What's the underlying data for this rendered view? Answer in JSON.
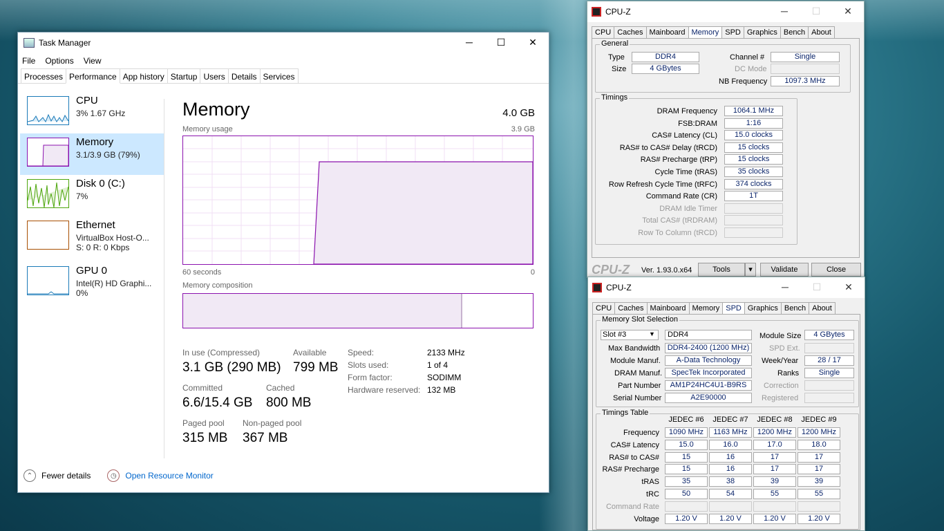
{
  "tm": {
    "title": "Task Manager",
    "menu": [
      "File",
      "Options",
      "View"
    ],
    "tabs": [
      "Processes",
      "Performance",
      "App history",
      "Startup",
      "Users",
      "Details",
      "Services"
    ],
    "sidebar": [
      {
        "name": "CPU",
        "sub": "3%  1.67 GHz",
        "sub2": ""
      },
      {
        "name": "Memory",
        "sub": "3.1/3.9 GB (79%)",
        "sub2": ""
      },
      {
        "name": "Disk 0 (C:)",
        "sub": "7%",
        "sub2": ""
      },
      {
        "name": "Ethernet",
        "sub": "VirtualBox Host-O...",
        "sub2": "S: 0  R: 0 Kbps"
      },
      {
        "name": "GPU 0",
        "sub": "Intel(R) HD Graphi...",
        "sub2": "0%"
      }
    ],
    "main": {
      "title": "Memory",
      "total": "4.0 GB",
      "usage_label": "Memory usage",
      "usage_max": "3.9 GB",
      "time_left": "60 seconds",
      "time_right": "0",
      "composition_label": "Memory composition",
      "in_use_k": "In use (Compressed)",
      "in_use_v": "3.1 GB (290 MB)",
      "available_k": "Available",
      "available_v": "799 MB",
      "committed_k": "Committed",
      "committed_v": "6.6/15.4 GB",
      "cached_k": "Cached",
      "cached_v": "800 MB",
      "paged_k": "Paged pool",
      "paged_v": "315 MB",
      "nonpaged_k": "Non-paged pool",
      "nonpaged_v": "367 MB",
      "speed_k": "Speed:",
      "speed_v": "2133 MHz",
      "slots_k": "Slots used:",
      "slots_v": "1 of 4",
      "form_k": "Form factor:",
      "form_v": "SODIMM",
      "hwres_k": "Hardware reserved:",
      "hwres_v": "132 MB"
    },
    "footer": {
      "fewer": "Fewer details",
      "monitor": "Open Resource Monitor"
    }
  },
  "cz1": {
    "title": "CPU-Z",
    "tabs": [
      "CPU",
      "Caches",
      "Mainboard",
      "Memory",
      "SPD",
      "Graphics",
      "Bench",
      "About"
    ],
    "general": "General",
    "type_k": "Type",
    "type_v": "DDR4",
    "size_k": "Size",
    "size_v": "4 GBytes",
    "channel_k": "Channel #",
    "channel_v": "Single",
    "dcmode_k": "DC Mode",
    "nbfreq_k": "NB Frequency",
    "nbfreq_v": "1097.3 MHz",
    "timings": "Timings",
    "rows": [
      {
        "k": "DRAM Frequency",
        "v": "1064.1 MHz"
      },
      {
        "k": "FSB:DRAM",
        "v": "1:16"
      },
      {
        "k": "CAS# Latency (CL)",
        "v": "15.0 clocks"
      },
      {
        "k": "RAS# to CAS# Delay (tRCD)",
        "v": "15 clocks"
      },
      {
        "k": "RAS# Precharge (tRP)",
        "v": "15 clocks"
      },
      {
        "k": "Cycle Time (tRAS)",
        "v": "35 clocks"
      },
      {
        "k": "Row Refresh Cycle Time (tRFC)",
        "v": "374 clocks"
      },
      {
        "k": "Command Rate (CR)",
        "v": "1T"
      },
      {
        "k": "DRAM Idle Timer",
        "v": ""
      },
      {
        "k": "Total CAS# (tRDRAM)",
        "v": ""
      },
      {
        "k": "Row To Column (tRCD)",
        "v": ""
      }
    ],
    "logo": "CPU-Z",
    "version": "Ver. 1.93.0.x64",
    "tools": "Tools",
    "validate": "Validate",
    "close": "Close"
  },
  "cz2": {
    "title": "CPU-Z",
    "tabs": [
      "CPU",
      "Caches",
      "Mainboard",
      "Memory",
      "SPD",
      "Graphics",
      "Bench",
      "About"
    ],
    "slotsel": "Memory Slot Selection",
    "slot": "Slot #3",
    "slot_type": "DDR4",
    "maxbw_k": "Max Bandwidth",
    "maxbw_v": "DDR4-2400 (1200 MHz)",
    "modman_k": "Module Manuf.",
    "modman_v": "A-Data Technology",
    "drman_k": "DRAM Manuf.",
    "drman_v": "SpecTek Incorporated",
    "part_k": "Part Number",
    "part_v": "AM1P24HC4U1-B9RS",
    "serial_k": "Serial Number",
    "serial_v": "A2E90000",
    "modsize_k": "Module Size",
    "modsize_v": "4 GBytes",
    "spdext_k": "SPD Ext.",
    "week_k": "Week/Year",
    "week_v": "28 / 17",
    "ranks_k": "Ranks",
    "ranks_v": "Single",
    "corr_k": "Correction",
    "reg_k": "Registered",
    "ttable": "Timings Table",
    "cols": [
      "JEDEC #6",
      "JEDEC #7",
      "JEDEC #8",
      "JEDEC #9"
    ],
    "trows": [
      {
        "k": "Frequency",
        "v": [
          "1090 MHz",
          "1163 MHz",
          "1200 MHz",
          "1200 MHz"
        ]
      },
      {
        "k": "CAS# Latency",
        "v": [
          "15.0",
          "16.0",
          "17.0",
          "18.0"
        ]
      },
      {
        "k": "RAS# to CAS#",
        "v": [
          "15",
          "16",
          "17",
          "17"
        ]
      },
      {
        "k": "RAS# Precharge",
        "v": [
          "15",
          "16",
          "17",
          "17"
        ]
      },
      {
        "k": "tRAS",
        "v": [
          "35",
          "38",
          "39",
          "39"
        ]
      },
      {
        "k": "tRC",
        "v": [
          "50",
          "54",
          "55",
          "55"
        ]
      },
      {
        "k": "Command Rate",
        "v": [
          "",
          "",
          "",
          ""
        ]
      },
      {
        "k": "Voltage",
        "v": [
          "1.20 V",
          "1.20 V",
          "1.20 V",
          "1.20 V"
        ]
      }
    ]
  }
}
